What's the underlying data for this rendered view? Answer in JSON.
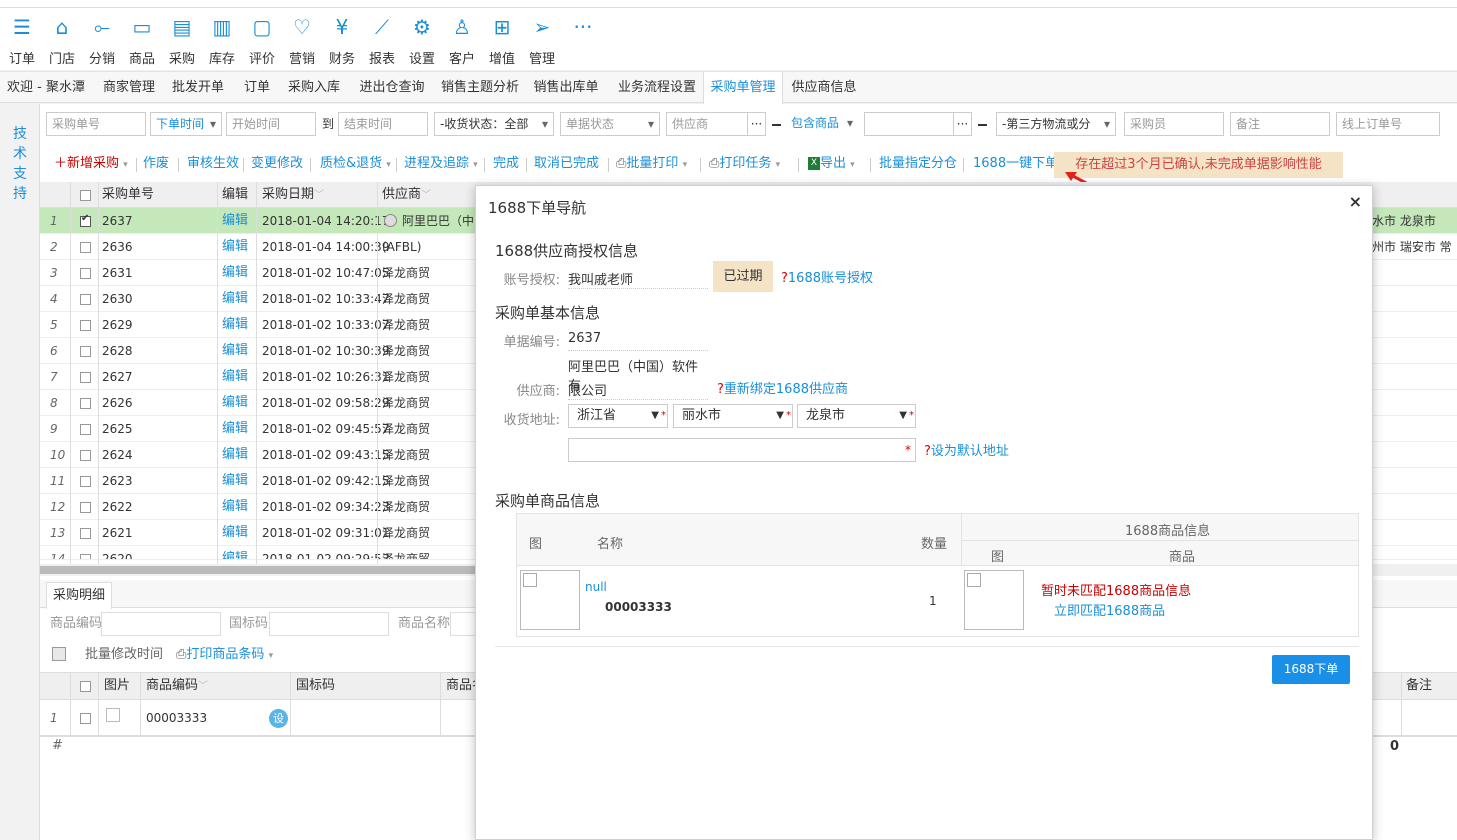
{
  "nav": [
    {
      "label": "订单",
      "icon": "order-icon",
      "glyph": "☰"
    },
    {
      "label": "门店",
      "icon": "store-icon",
      "glyph": "⌂"
    },
    {
      "label": "分销",
      "icon": "distribution-icon",
      "glyph": "⟜"
    },
    {
      "label": "商品",
      "icon": "goods-icon",
      "glyph": "▭"
    },
    {
      "label": "采购",
      "icon": "purchase-icon",
      "glyph": "▤"
    },
    {
      "label": "库存",
      "icon": "stock-icon",
      "glyph": "▥"
    },
    {
      "label": "评价",
      "icon": "comment-icon",
      "glyph": "▢"
    },
    {
      "label": "营销",
      "icon": "heart-icon",
      "glyph": "♡"
    },
    {
      "label": "财务",
      "icon": "yen-icon",
      "glyph": "¥"
    },
    {
      "label": "报表",
      "icon": "chart-icon",
      "glyph": "⟋"
    },
    {
      "label": "设置",
      "icon": "gear-icon",
      "glyph": "⚙"
    },
    {
      "label": "客户",
      "icon": "user-icon",
      "glyph": "♙"
    },
    {
      "label": "增值",
      "icon": "apps-icon",
      "glyph": "⊞"
    },
    {
      "label": "管理",
      "icon": "cursor-icon",
      "glyph": "➢"
    },
    {
      "label": "",
      "icon": "more-icon",
      "glyph": "···"
    }
  ],
  "tabs": [
    "欢迎 - 聚水潭",
    "商家管理",
    "批发开单",
    "订单",
    "采购入库",
    "进出仓查询",
    "销售主题分析",
    "销售出库单",
    "业务流程设置",
    "采购单管理",
    "供应商信息"
  ],
  "sidebar_text": "技术支持",
  "filters": {
    "purchase_no": "采购单号",
    "order_time": "下单时间",
    "start_time": "开始时间",
    "to": "到",
    "end_time": "结束时间",
    "receive_status": "-收货状态：全部",
    "doc_status": "单据状态",
    "supplier": "供应商",
    "contains_goods": "包含商品",
    "logistics": "-第三方物流或分",
    "buyer": "采购员",
    "remark": "备注",
    "online_order": "线上订单号"
  },
  "toolbar": {
    "new": "新增采购",
    "void": "作废",
    "approve": "审核生效",
    "change": "变更修改",
    "qc": "质检&退货",
    "progress": "进程及追踪",
    "done": "完成",
    "cancel_done": "取消已完成",
    "batch_print": "批量打印",
    "print_task": "打印任务",
    "export": "导出",
    "assign": "批量指定分仓",
    "one_click": "1688一键下单",
    "notice": "存在超过3个月已确认,未完成单据影响性能"
  },
  "grid": {
    "headers": {
      "no": "采购单号",
      "edit": "编辑",
      "date": "采购日期",
      "supplier": "供应商"
    },
    "rows": [
      {
        "n": "1",
        "id": "2637",
        "edit": "编辑",
        "date": "2018-01-04 14:20:17",
        "sup": "阿里巴巴（中",
        "city": "丽水市 龙泉市"
      },
      {
        "n": "2",
        "id": "2636",
        "edit": "编辑",
        "date": "2018-01-04 14:00:39",
        "sup": "(AFBL)",
        "city": "温州市 瑞安市 常"
      },
      {
        "n": "3",
        "id": "2631",
        "edit": "编辑",
        "date": "2018-01-02 10:47:05",
        "sup": "泽龙商贸",
        "city": ""
      },
      {
        "n": "4",
        "id": "2630",
        "edit": "编辑",
        "date": "2018-01-02 10:33:47",
        "sup": "泽龙商贸",
        "city": ""
      },
      {
        "n": "5",
        "id": "2629",
        "edit": "编辑",
        "date": "2018-01-02 10:33:07",
        "sup": "泽龙商贸",
        "city": ""
      },
      {
        "n": "6",
        "id": "2628",
        "edit": "编辑",
        "date": "2018-01-02 10:30:39",
        "sup": "泽龙商贸",
        "city": ""
      },
      {
        "n": "7",
        "id": "2627",
        "edit": "编辑",
        "date": "2018-01-02 10:26:31",
        "sup": "泽龙商贸",
        "city": ""
      },
      {
        "n": "8",
        "id": "2626",
        "edit": "编辑",
        "date": "2018-01-02 09:58:29",
        "sup": "泽龙商贸",
        "city": ""
      },
      {
        "n": "9",
        "id": "2625",
        "edit": "编辑",
        "date": "2018-01-02 09:45:57",
        "sup": "泽龙商贸",
        "city": ""
      },
      {
        "n": "10",
        "id": "2624",
        "edit": "编辑",
        "date": "2018-01-02 09:43:15",
        "sup": "泽龙商贸",
        "city": ""
      },
      {
        "n": "11",
        "id": "2623",
        "edit": "编辑",
        "date": "2018-01-02 09:42:15",
        "sup": "泽龙商贸",
        "city": ""
      },
      {
        "n": "12",
        "id": "2622",
        "edit": "编辑",
        "date": "2018-01-02 09:34:23",
        "sup": "泽龙商贸",
        "city": ""
      },
      {
        "n": "13",
        "id": "2621",
        "edit": "编辑",
        "date": "2018-01-02 09:31:01",
        "sup": "泽龙商贸",
        "city": ""
      },
      {
        "n": "14",
        "id": "2620",
        "edit": "编辑",
        "date": "2018-01-02 09:29:53",
        "sup": "泽龙商贸",
        "city": ""
      }
    ]
  },
  "detail": {
    "tab": "采购明细",
    "goods_code": "商品编码",
    "barcode": "国标码",
    "goods_name": "商品名称",
    "batch_time": "批量修改时间",
    "print_barcode": "打印商品条码",
    "headers": {
      "pic": "图片",
      "code": "商品编码",
      "barcode": "国标码",
      "name": "商品名",
      "remark": "备注"
    },
    "row": {
      "n": "1",
      "code": "00003333",
      "set": "设"
    },
    "footer": {
      "hash": "#",
      "zero": "0"
    }
  },
  "modal": {
    "title": "1688下单导航",
    "auth_section": "1688供应商授权信息",
    "account_label": "账号授权:",
    "account_value": "我叫戚老师",
    "expired": "已过期",
    "auth_link": "1688账号授权",
    "basic_section": "采购单基本信息",
    "doc_label": "单据编号:",
    "doc_value": "2637",
    "supplier_label": "供应商:",
    "supplier_line1": "阿里巴巴（中国）软件有",
    "supplier_line2": "限公司",
    "rebind_link": "重新绑定1688供应商",
    "address_label": "收货地址:",
    "province": "浙江省",
    "city": "丽水市",
    "district": "龙泉市",
    "default_link": "设为默认地址",
    "goods_section": "采购单商品信息",
    "th_img": "图",
    "th_name": "名称",
    "th_qty": "数量",
    "th_1688": "1688商品信息",
    "th_1688_img": "图",
    "th_1688_goods": "商品",
    "item_name": "null",
    "item_code": "00003333",
    "item_qty": "1",
    "unmatched_pre": "暂时未匹配",
    "unmatched_post": "1688商品信息",
    "match_pre": "立即匹配",
    "match_post": "1688商品",
    "submit": "1688下单",
    "close": "×",
    "qmark": "?"
  },
  "colors": {
    "accent": "#1a8fd8",
    "selected_row": "#c5e8bb",
    "notice_bg": "#f5e3c6",
    "button": "#1a8fe8"
  }
}
